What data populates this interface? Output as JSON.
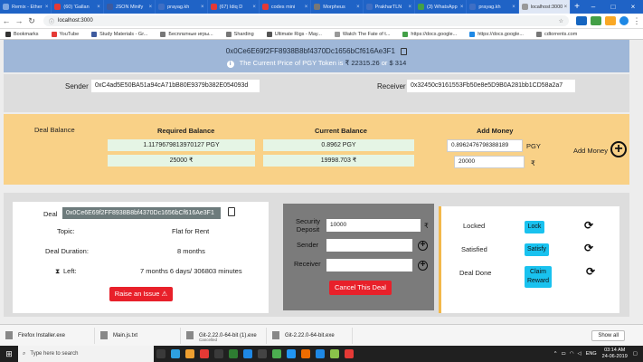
{
  "browser": {
    "tabs": [
      {
        "label": "Remix - Ether",
        "color": "#7ea6e0"
      },
      {
        "label": "(60) 'Gallan",
        "color": "#e53935"
      },
      {
        "label": "JSON Minify",
        "color": "#3d5a9e"
      },
      {
        "label": "prayag.kh",
        "color": "#3f6fc4"
      },
      {
        "label": "(67) Idiq D",
        "color": "#e53935"
      },
      {
        "label": "codes mini",
        "color": "#e53935"
      },
      {
        "label": "Morpheus",
        "color": "#777"
      },
      {
        "label": "PrakharTLN",
        "color": "#3f6fc4"
      },
      {
        "label": "(3) WhatsApp",
        "color": "#43a047"
      },
      {
        "label": "prayag.kh",
        "color": "#3f6fc4"
      },
      {
        "label": "localhost:3000",
        "color": "#999"
      }
    ],
    "url": "localhost:3000",
    "bookmarks": [
      {
        "label": "Bookmarks",
        "color": "#333"
      },
      {
        "label": "YouTube",
        "color": "#e53935"
      },
      {
        "label": "Study Materials - Gr...",
        "color": "#3d5a9e"
      },
      {
        "label": "Бесплатные игры...",
        "color": "#777"
      },
      {
        "label": "Sharding",
        "color": "#777"
      },
      {
        "label": "Ultimate Rigs - May...",
        "color": "#555"
      },
      {
        "label": "Watch The Fate of t...",
        "color": "#999"
      },
      {
        "label": "https://docs.google...",
        "color": "#43a047"
      },
      {
        "label": "https://docs.google...",
        "color": "#1e88e5"
      },
      {
        "label": "cdtorrents.com",
        "color": "#777"
      }
    ]
  },
  "header": {
    "contract_address": "0x0Ce6E69f2FF8938B8bf4370Dc1656bCf616Ae3F1",
    "price_prefix": "The Current Price of PGY Token is",
    "price_inr": "₹ 22315.26",
    "price_or": "or",
    "price_usd": "$ 314"
  },
  "parties": {
    "sender_label": "Sender",
    "sender_address": "0xC4ad5E50BA51a94cA71bB80E9379b382E054093d",
    "receiver_label": "Receiver",
    "receiver_address": "0x32450c9161553Fb50e8e5D9B0A281bb1CD58a2a7"
  },
  "deal_balance": {
    "label": "Deal Balance",
    "required_header": "Required Balance",
    "current_header": "Current Balance",
    "add_header": "Add Money",
    "required_pgy": "1.1179679813970127 PGY",
    "required_inr": "25000 ₹",
    "current_pgy": "0.8962 PGY",
    "current_inr": "19998.703 ₹",
    "add_pgy_value": "0.8962476798388189",
    "add_pgy_unit": "PGY",
    "add_inr_value": "20000",
    "add_inr_unit": "₹",
    "add_button_label": "Add Money"
  },
  "deal_info": {
    "deal_label": "Deal",
    "deal_id": "0x0Ce6E69f2FF8938B8bf4370Dc1656bCf616Ae3F1",
    "topic_label": "Topic:",
    "topic_value": "Flat for Rent",
    "duration_label": "Deal Duration:",
    "duration_value": "8 months",
    "left_label": "Left:",
    "left_value": "7 months 6 days/ 306803 minutes",
    "issue_button": "Raise an Issue"
  },
  "deposit_form": {
    "security_label": "Security Deposit",
    "security_value": "10000",
    "security_unit": "₹",
    "sender_label": "Sender",
    "receiver_label": "Receiver",
    "cancel_button": "Cancel This Deal"
  },
  "status": {
    "locked_label": "Locked",
    "lock_button": "Lock",
    "satisfied_label": "Satisfied",
    "satisfy_button": "Satisfy",
    "done_label": "Deal Done",
    "claim_button": "Claim Reward"
  },
  "downloads": [
    {
      "label": "Firefox Installer.exe",
      "sub": ""
    },
    {
      "label": "Main.js.txt",
      "sub": ""
    },
    {
      "label": "Git-2.22.0-64-bit (1).exe",
      "sub": "Cancelled"
    },
    {
      "label": "Git-2.22.0-64-bit.exe",
      "sub": ""
    }
  ],
  "show_all_label": "Show all",
  "taskbar": {
    "search_placeholder": "Type here to search",
    "lang": "ENG",
    "time": "03:14 AM",
    "date": "24-06-2019",
    "icons": [
      "#3a3a3a",
      "#2ea0e0",
      "#f0a030",
      "#e53935",
      "#3a3a3a",
      "#2e7d32",
      "#1e88e5",
      "#444",
      "#4caf50",
      "#2196f3",
      "#ef6c00",
      "#1e88e5",
      "#8bc34a",
      "#e53935"
    ]
  }
}
